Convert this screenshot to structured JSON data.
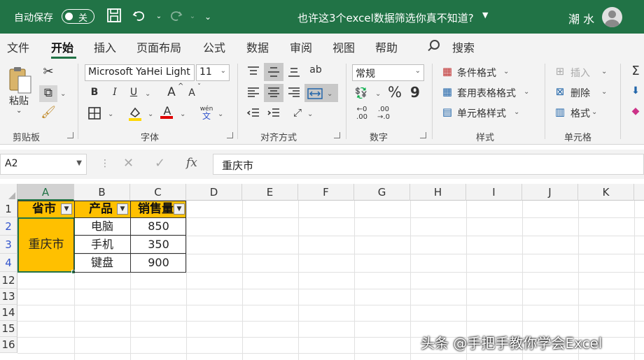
{
  "titlebar": {
    "autosave_label": "自动保存",
    "autosave_state": "关",
    "doc_title": "也许这3个excel数据筛选你真不知道?",
    "user_name": "潮 水",
    "save_icon": "save-icon",
    "undo_icon": "undo-icon",
    "redo_icon": "redo-icon"
  },
  "menu": {
    "tabs": [
      "文件",
      "开始",
      "插入",
      "页面布局",
      "公式",
      "数据",
      "审阅",
      "视图",
      "帮助"
    ],
    "active": "开始",
    "search_label": "搜索"
  },
  "ribbon": {
    "clipboard": {
      "paste_label": "粘贴",
      "group_label": "剪贴板"
    },
    "font": {
      "font_name": "Microsoft YaHei Light",
      "font_size": "11",
      "bold": "B",
      "italic": "I",
      "underline": "U",
      "grow": "A",
      "shrink": "A",
      "font_color_letter": "A",
      "phonetic_top": "wén",
      "phonetic_bottom": "文",
      "group_label": "字体",
      "highlight_color": "#ffd700",
      "font_color": "#e00000"
    },
    "alignment": {
      "group_label": "对齐方式"
    },
    "number": {
      "format": "常规",
      "percent": "%",
      "comma": "9",
      "inc_decimal_a": "←0",
      "inc_decimal_b": ".00",
      "dec_decimal_a": ".00",
      "dec_decimal_b": "→.0",
      "group_label": "数字"
    },
    "styles": {
      "conditional": "条件格式",
      "table_format": "套用表格格式",
      "cell_styles": "单元格样式",
      "group_label": "样式"
    },
    "cells": {
      "insert": "插入",
      "delete": "删除",
      "format": "格式",
      "group_label": "单元格"
    },
    "editing": {
      "sum_icon": "Σ"
    }
  },
  "formula_bar": {
    "name_box": "A2",
    "content": "重庆市",
    "fx_label": "fx"
  },
  "grid": {
    "columns": [
      "A",
      "B",
      "C",
      "D",
      "E",
      "F",
      "G",
      "H",
      "I",
      "J",
      "K"
    ],
    "rows": [
      "1",
      "2",
      "3",
      "4",
      "12",
      "13",
      "14",
      "15",
      "16"
    ],
    "headers": [
      "省市",
      "产品",
      "销售量"
    ],
    "merged_value": "重庆市",
    "products": [
      "电脑",
      "手机",
      "键盘"
    ],
    "sales": [
      "850",
      "350",
      "900"
    ],
    "header_fill": "#ffc000",
    "selection_color": "#217346"
  },
  "watermark": "头条 @手把手教你学会Excel"
}
